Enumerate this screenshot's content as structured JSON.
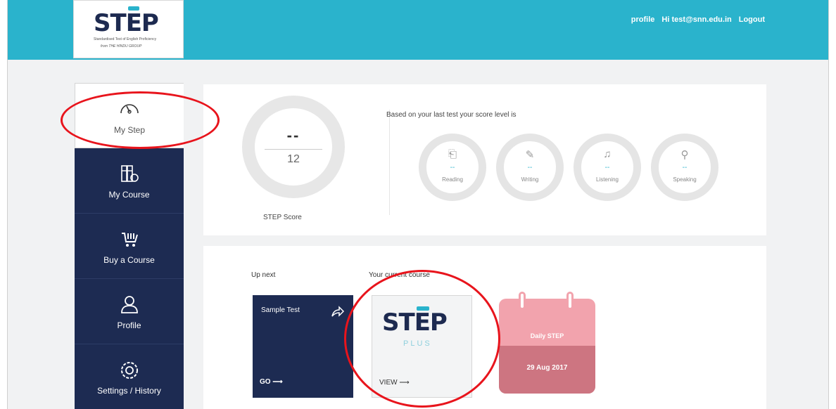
{
  "brand": {
    "logo_text_pre": "ST",
    "logo_text_e": "E",
    "logo_text_post": "P",
    "logo_tagline": "Standardised Test of English Proficiency",
    "logo_subline": "from THE HINDU GROUP"
  },
  "topnav": {
    "profile": "profile",
    "greeting": "Hi test@snn.edu.in",
    "logout": "Logout"
  },
  "sidebar": {
    "items": [
      {
        "label": "My Step",
        "icon": "speedometer-icon",
        "glyph": "⌒"
      },
      {
        "label": "My Course",
        "icon": "books-icon",
        "glyph": "▥"
      },
      {
        "label": "Buy a Course",
        "icon": "cart-icon",
        "glyph": "🛒"
      },
      {
        "label": "Profile",
        "icon": "user-icon",
        "glyph": "♙"
      },
      {
        "label": "Settings / History",
        "icon": "gear-icon",
        "glyph": "⚙"
      }
    ]
  },
  "score": {
    "value": "--",
    "max": "12",
    "label": "STEP Score",
    "level_text": "Based on your last test your score level is",
    "skills": [
      {
        "label": "Reading",
        "value": "--",
        "icon": "reading-icon",
        "glyph": "⎗"
      },
      {
        "label": "Writing",
        "value": "--",
        "icon": "writing-icon",
        "glyph": "✎"
      },
      {
        "label": "Listening",
        "value": "--",
        "icon": "listening-icon",
        "glyph": "♫"
      },
      {
        "label": "Speaking",
        "value": "--",
        "icon": "speaking-icon",
        "glyph": "⚲"
      }
    ]
  },
  "courses": {
    "up_next_label": "Up next",
    "current_label": "Your current course",
    "sample_title": "Sample Test",
    "sample_action": "GO ⟶",
    "plus_logo_pre": "ST",
    "plus_logo_e": "E",
    "plus_logo_post": "P",
    "plus_sub": "PLUS",
    "plus_action": "VIEW ⟶",
    "daily_title": "Daily STEP",
    "daily_date": "29 Aug 2017"
  },
  "colors": {
    "accent": "#2ab3cc",
    "navy": "#1d2b52",
    "calendar_pink": "#f2a3ad",
    "highlight_red": "#e8141c"
  }
}
